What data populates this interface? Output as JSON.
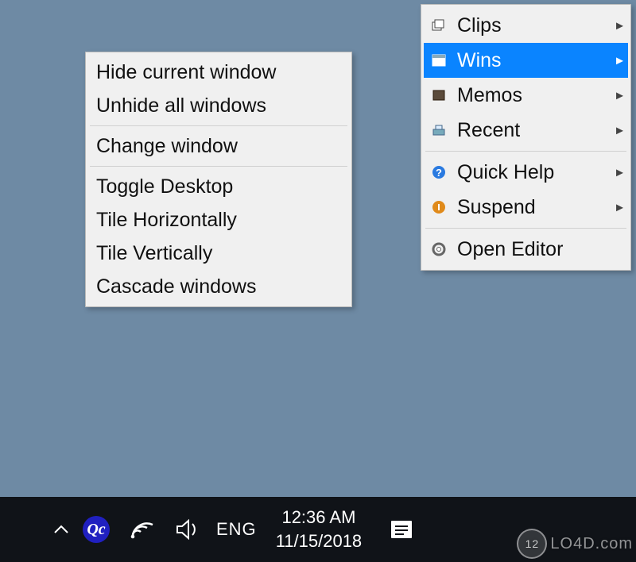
{
  "submenu": {
    "items": [
      {
        "label": "Hide current window"
      },
      {
        "label": "Unhide all windows"
      },
      {
        "label": "Change window"
      },
      {
        "label": "Toggle Desktop"
      },
      {
        "label": "Tile Horizontally"
      },
      {
        "label": "Tile Vertically"
      },
      {
        "label": "Cascade windows"
      }
    ]
  },
  "mainmenu": {
    "items": [
      {
        "label": "Clips",
        "icon": "cascade-icon",
        "submenu": true
      },
      {
        "label": "Wins",
        "icon": "window-icon",
        "submenu": true,
        "selected": true
      },
      {
        "label": "Memos",
        "icon": "book-icon",
        "submenu": true
      },
      {
        "label": "Recent",
        "icon": "tray-icon",
        "submenu": true
      },
      {
        "label": "Quick Help",
        "icon": "help-icon",
        "submenu": true
      },
      {
        "label": "Suspend",
        "icon": "suspend-icon",
        "submenu": true
      },
      {
        "label": "Open Editor",
        "icon": "gear-icon",
        "submenu": false
      }
    ]
  },
  "taskbar": {
    "qc_label": "Qc",
    "lang": "ENG",
    "time": "12:36 AM",
    "date": "11/15/2018"
  },
  "watermark": {
    "text": "LO4D.com",
    "badge": "12"
  }
}
